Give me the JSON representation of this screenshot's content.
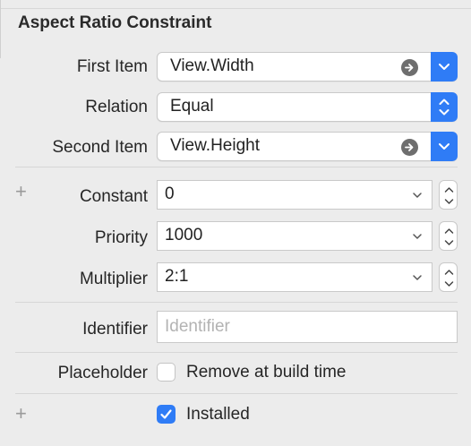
{
  "section": {
    "title": "Aspect Ratio Constraint"
  },
  "first_item": {
    "label": "First Item",
    "value": "View.Width"
  },
  "relation": {
    "label": "Relation",
    "value": "Equal"
  },
  "second_item": {
    "label": "Second Item",
    "value": "View.Height"
  },
  "constant": {
    "label": "Constant",
    "value": "0"
  },
  "priority": {
    "label": "Priority",
    "value": "1000"
  },
  "multiplier": {
    "label": "Multiplier",
    "value": "2:1"
  },
  "identifier": {
    "label": "Identifier",
    "value": "",
    "placeholder": "Identifier"
  },
  "placeholder_row": {
    "label": "Placeholder",
    "checkbox_label": "Remove at build time",
    "checked": false
  },
  "installed": {
    "checkbox_label": "Installed",
    "checked": true
  },
  "colors": {
    "accent": "#2f7cf6",
    "background": "#ececec"
  }
}
